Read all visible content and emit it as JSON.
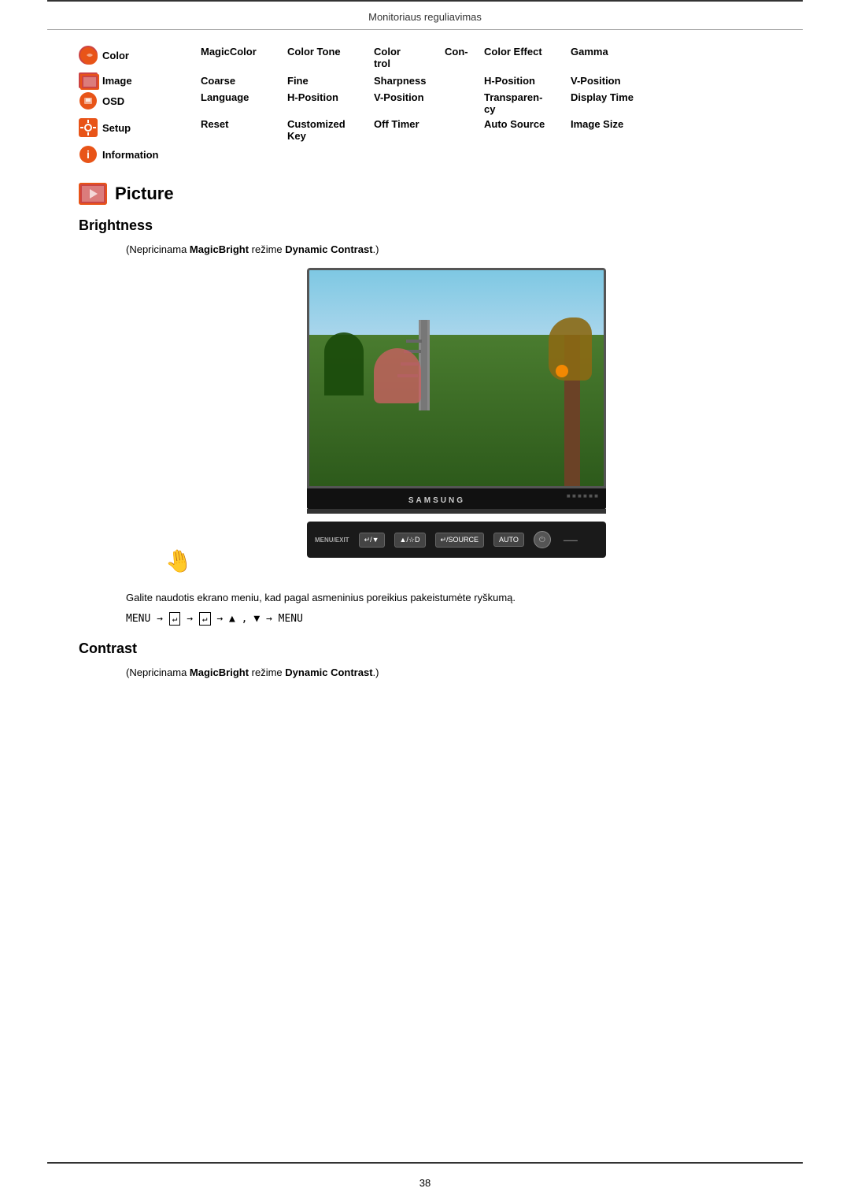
{
  "header": {
    "title": "Monitoriaus reguliavimas"
  },
  "menu": {
    "rows": [
      {
        "item": "Color",
        "icon": "color",
        "options": [
          "MagicColor",
          "Color Tone",
          "Color\ntrol",
          "Con-",
          "Color Effect",
          "Gamma"
        ]
      },
      {
        "item": "Image",
        "icon": "image",
        "options": [
          "Coarse",
          "Fine",
          "Sharpness",
          "",
          "H-Position",
          "V-Position"
        ]
      },
      {
        "item": "OSD",
        "icon": "osd",
        "options": [
          "Language",
          "H-Position",
          "V-Position",
          "",
          "Transparen-\ncy",
          "Display Time"
        ]
      },
      {
        "item": "Setup",
        "icon": "setup",
        "options": [
          "Reset",
          "Customized\nKey",
          "Off Timer",
          "",
          "Auto Source",
          "Image Size"
        ]
      },
      {
        "item": "Information",
        "icon": "info",
        "options": []
      }
    ]
  },
  "sections": {
    "picture": {
      "icon": "picture-icon",
      "title": "Picture"
    },
    "brightness": {
      "title": "Brightness",
      "subtitle_pre": "(Nepricinama ",
      "subtitle_brand": "MagicBright",
      "subtitle_mid": " režime ",
      "subtitle_mode": "Dynamic Contrast",
      "subtitle_post": ".)",
      "body_text": "Galite naudotis ekrano meniu, kad pagal asmeninius poreikius pakeistumėte ryškumą.",
      "menu_path": "MENU → ↵ → ↵ → ▲ , ▼ → MENU"
    },
    "contrast": {
      "title": "Contrast",
      "subtitle_pre": "(Nepricinama ",
      "subtitle_brand": "MagicBright",
      "subtitle_mid": " režime ",
      "subtitle_mode": "Dynamic Contrast",
      "subtitle_post": ".)"
    }
  },
  "monitor": {
    "brand": "SAMSUNG"
  },
  "controls": {
    "menu_label": "MENU/EXIT",
    "btn1": "↵/▼",
    "btn2": "▲/☆D",
    "btn3": "↵/SOURCE",
    "btn4": "AUTO"
  },
  "page_number": "38"
}
